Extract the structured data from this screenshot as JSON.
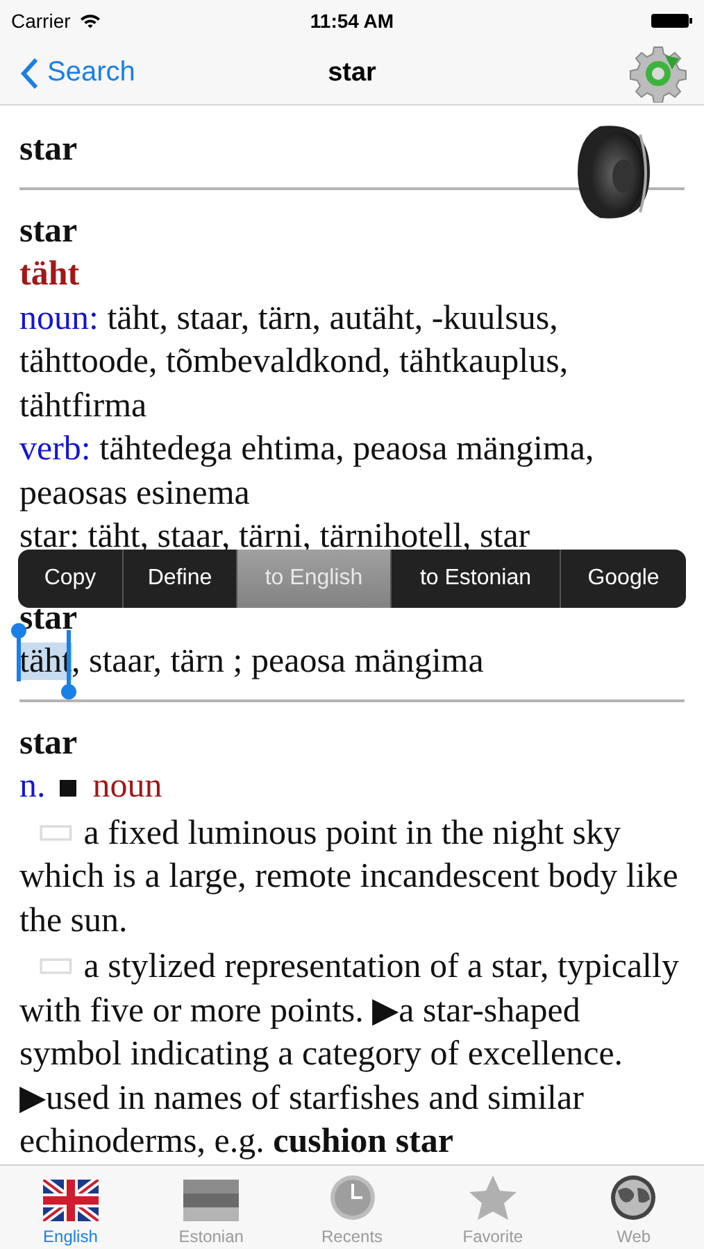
{
  "status_bar": {
    "carrier": "Carrier",
    "time": "11:54 AM"
  },
  "nav_bar": {
    "back": "Search",
    "title": "star"
  },
  "entries": [
    {
      "kind": "headword",
      "word": "star"
    },
    {
      "kind": "translation",
      "word": "star",
      "translation": "täht",
      "lines": [
        {
          "pos": "noun:",
          "text": "täht, staar, tärn, autäht, -kuulsus, tähttoode, tõmbevaldkond, tähtkauplus, tähtfirma"
        },
        {
          "pos": "verb:",
          "text": "tähtedega ehtima, peaosa mängima, peaosas esinema"
        },
        {
          "text": "star: täht, staar, tärni, tärnihotell, star"
        }
      ]
    },
    {
      "kind": "short",
      "word": "star",
      "selected_text": "täht",
      "text": ", staar, tärn ; peaosa mängima"
    },
    {
      "kind": "definition",
      "word": "star",
      "abbr": "n.",
      "pos": "noun",
      "senses": [
        "▭ a fixed luminous point in the night sky which is a large, remote incandescent body like the sun.",
        "▭ a stylized representation of a star, typically with five or more points. ▶a star-shaped symbol indicating a category of excellence. ▶used in names of starfishes and similar echinoderms, e.g. **cushion star**"
      ]
    }
  ],
  "context_menu": [
    {
      "label": "Copy",
      "selected": false
    },
    {
      "label": "Define",
      "selected": false
    },
    {
      "label": "to English",
      "selected": true
    },
    {
      "label": "to Estonian",
      "selected": false
    },
    {
      "label": "Google",
      "selected": false
    }
  ],
  "tab_bar": [
    {
      "label": "English",
      "selected": true
    },
    {
      "label": "Estonian",
      "selected": false
    },
    {
      "label": "Recents",
      "selected": false
    },
    {
      "label": "Favorite",
      "selected": false
    },
    {
      "label": "Web",
      "selected": false
    }
  ]
}
